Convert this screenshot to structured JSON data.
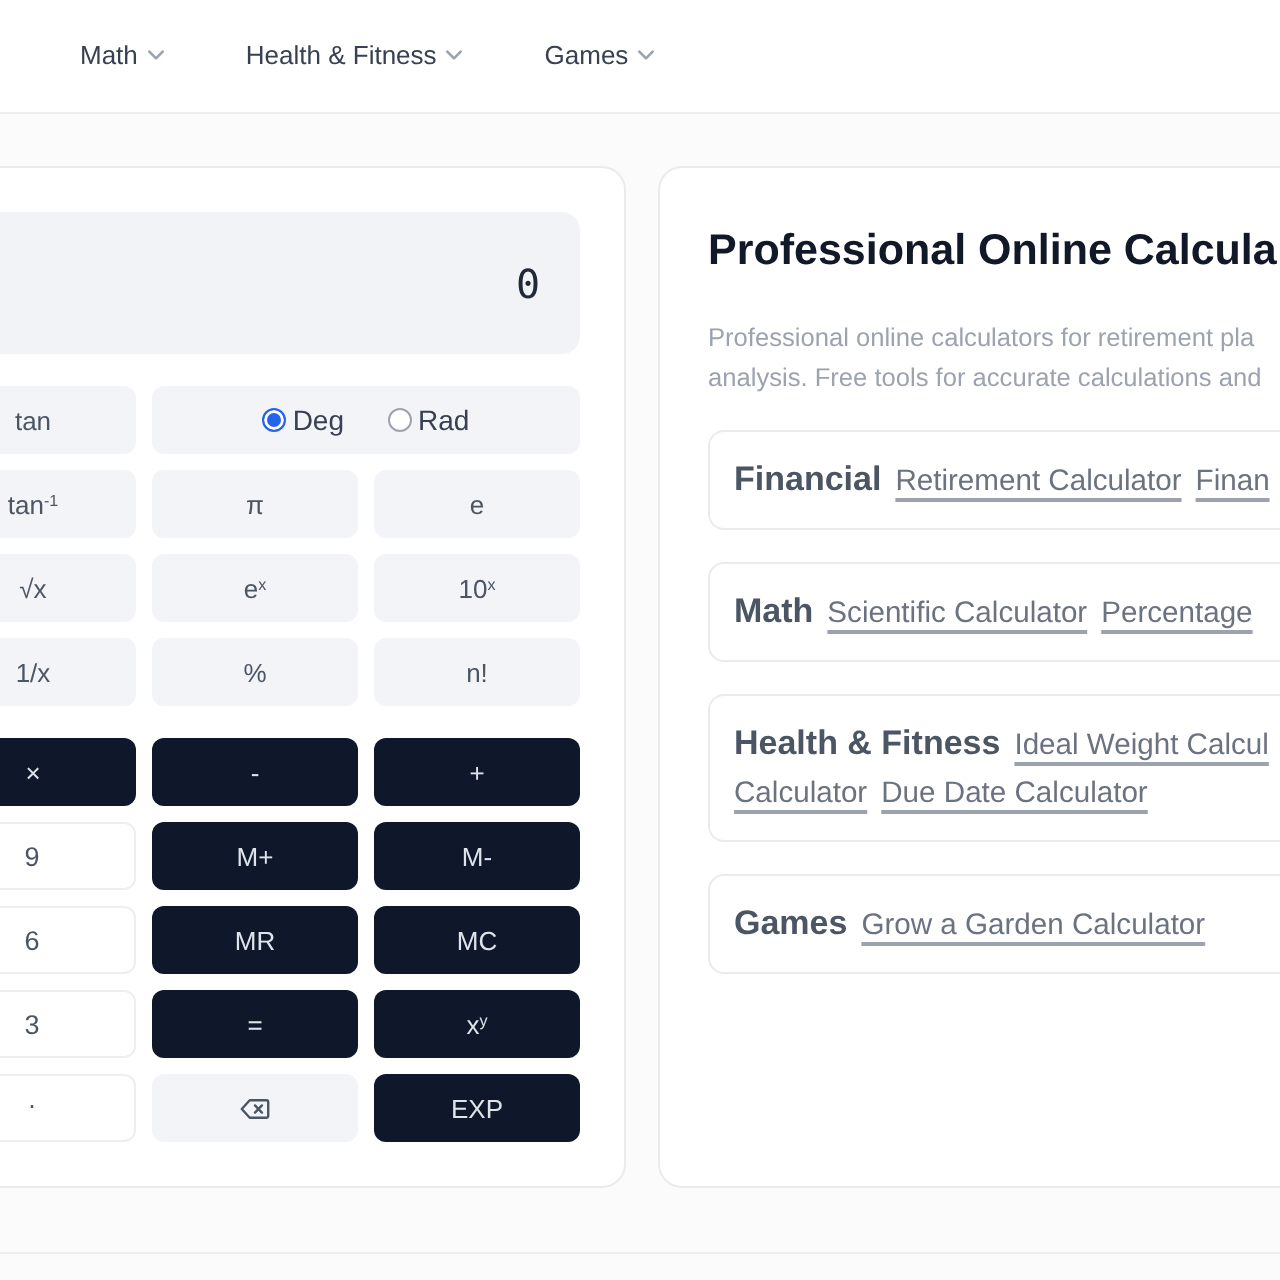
{
  "nav": {
    "items": [
      {
        "label": "Math"
      },
      {
        "label": "Health & Fitness"
      },
      {
        "label": "Games"
      }
    ]
  },
  "calculator": {
    "display": "0",
    "function_keys": [
      {
        "kind": "function",
        "label": "tan"
      },
      {
        "kind": "angle",
        "options": [
          {
            "label": "Deg",
            "selected": true
          },
          {
            "label": "Rad",
            "selected": false
          }
        ]
      },
      {
        "kind": "function",
        "label": "tan$^{-1}$"
      },
      {
        "kind": "function",
        "label": "π"
      },
      {
        "kind": "function",
        "label": "e"
      },
      {
        "kind": "function",
        "label": "√x"
      },
      {
        "kind": "function",
        "label": "e$^{x}$"
      },
      {
        "kind": "function",
        "label": "10$^{x}$"
      },
      {
        "kind": "function",
        "label": "1/x"
      },
      {
        "kind": "function",
        "label": "%"
      },
      {
        "kind": "function",
        "label": "n!"
      }
    ],
    "main_keys": [
      {
        "kind": "operator",
        "label": "×"
      },
      {
        "kind": "operator",
        "label": "-"
      },
      {
        "kind": "operator",
        "label": "+"
      },
      {
        "kind": "digit",
        "label": "9"
      },
      {
        "kind": "operator",
        "label": "M+"
      },
      {
        "kind": "operator",
        "label": "M-"
      },
      {
        "kind": "digit",
        "label": "6"
      },
      {
        "kind": "operator",
        "label": "MR"
      },
      {
        "kind": "operator",
        "label": "MC"
      },
      {
        "kind": "digit",
        "label": "3"
      },
      {
        "kind": "operator",
        "label": "="
      },
      {
        "kind": "operator",
        "label": "x$^{y}$"
      },
      {
        "kind": "decimal",
        "label": "."
      },
      {
        "kind": "backspace"
      },
      {
        "kind": "operator",
        "label": "EXP"
      }
    ]
  },
  "intro": {
    "title": "Professional Online Calcula",
    "description_lines": [
      "Professional online calculators for retirement pla",
      "analysis. Free tools for accurate calculations and"
    ],
    "categories": [
      {
        "label": "Financial",
        "links": [
          "Retirement Calculator",
          "Finan"
        ]
      },
      {
        "label": "Math",
        "links": [
          "Scientific Calculator",
          "Percentage"
        ]
      },
      {
        "label": "Health & Fitness",
        "links": [
          "Ideal Weight Calcul",
          "Calculator",
          "Due Date Calculator"
        ]
      },
      {
        "label": "Games",
        "links": [
          "Grow a Garden Calculator"
        ]
      }
    ]
  }
}
